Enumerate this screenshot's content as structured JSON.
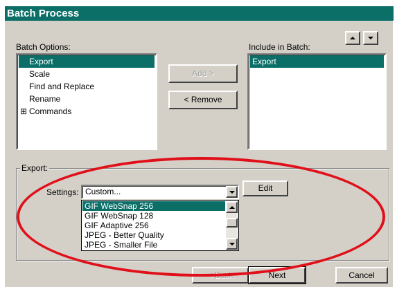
{
  "window": {
    "title": "Batch Process"
  },
  "batch_options": {
    "label": "Batch Options:",
    "items": [
      {
        "label": "Export",
        "selected": true
      },
      {
        "label": "Scale",
        "selected": false
      },
      {
        "label": "Find and Replace",
        "selected": false
      },
      {
        "label": "Rename",
        "selected": false
      },
      {
        "label": "Commands",
        "selected": false,
        "expander": "⊞"
      }
    ]
  },
  "include_in_batch": {
    "label": "Include in Batch:",
    "items": [
      {
        "label": "Export",
        "selected": true
      }
    ]
  },
  "buttons": {
    "add": "Add >",
    "remove": "< Remove",
    "edit": "Edit",
    "back": "< Back",
    "next": "Next",
    "cancel": "Cancel"
  },
  "export_group": {
    "label": "Export:",
    "settings_label": "Settings:",
    "settings_value": "Custom...",
    "options": [
      {
        "label": "GIF WebSnap 256",
        "selected": true
      },
      {
        "label": "GIF WebSnap 128",
        "selected": false
      },
      {
        "label": "GIF Adaptive 256",
        "selected": false
      },
      {
        "label": "JPEG - Better Quality",
        "selected": false
      },
      {
        "label": "JPEG - Smaller File",
        "selected": false
      }
    ]
  },
  "colors": {
    "accent": "#0b6f68",
    "annotation": "#e0101a",
    "face": "#d4d0c8"
  }
}
